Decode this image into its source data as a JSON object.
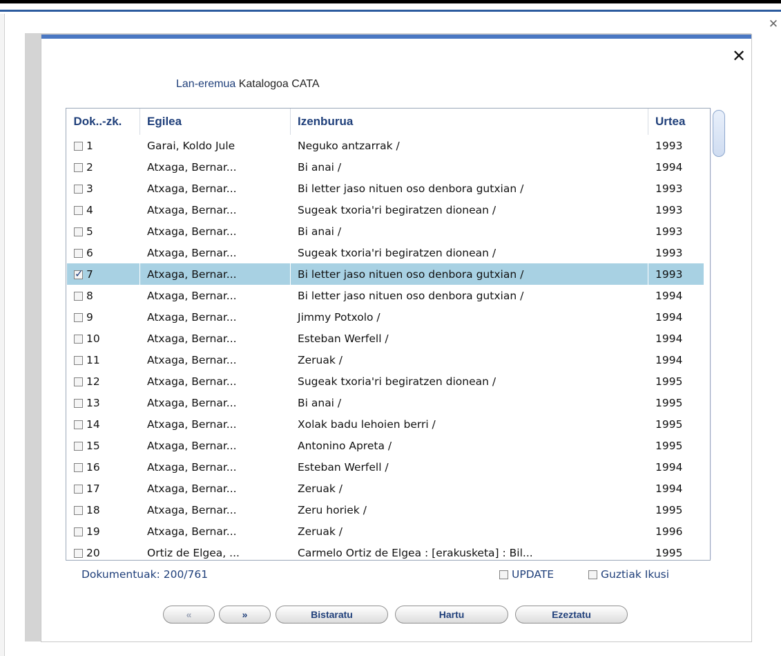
{
  "workspace": {
    "label": "Lan-eremua",
    "value": "Katalogoa CATA"
  },
  "columns": {
    "doc": "Dok..-zk.",
    "author": "Egilea",
    "title": "Izenburua",
    "year": "Urtea"
  },
  "rows": [
    {
      "num": "1",
      "author": "Garai, Koldo Jule",
      "title": "Neguko antzarrak /",
      "year": "1993",
      "checked": false
    },
    {
      "num": "2",
      "author": "Atxaga, Bernar...",
      "title": "Bi anai /",
      "year": "1994",
      "checked": false
    },
    {
      "num": "3",
      "author": "Atxaga, Bernar...",
      "title": "Bi letter jaso nituen oso denbora gutxian /",
      "year": "1993",
      "checked": false
    },
    {
      "num": "4",
      "author": "Atxaga, Bernar...",
      "title": "Sugeak txoria'ri begiratzen dionean /",
      "year": "1993",
      "checked": false
    },
    {
      "num": "5",
      "author": "Atxaga, Bernar...",
      "title": "Bi anai /",
      "year": "1993",
      "checked": false
    },
    {
      "num": "6",
      "author": "Atxaga, Bernar...",
      "title": "Sugeak txoria'ri begiratzen dionean /",
      "year": "1993",
      "checked": false
    },
    {
      "num": "7",
      "author": "Atxaga, Bernar...",
      "title": "Bi letter jaso nituen oso denbora gutxian /",
      "year": "1993",
      "checked": true
    },
    {
      "num": "8",
      "author": "Atxaga, Bernar...",
      "title": "Bi letter jaso nituen oso denbora gutxian /",
      "year": "1994",
      "checked": false
    },
    {
      "num": "9",
      "author": "Atxaga, Bernar...",
      "title": "Jimmy Potxolo /",
      "year": "1994",
      "checked": false
    },
    {
      "num": "10",
      "author": "Atxaga, Bernar...",
      "title": "Esteban Werfell /",
      "year": "1994",
      "checked": false
    },
    {
      "num": "11",
      "author": "Atxaga, Bernar...",
      "title": "Zeruak /",
      "year": "1994",
      "checked": false
    },
    {
      "num": "12",
      "author": "Atxaga, Bernar...",
      "title": "Sugeak txoria'ri begiratzen dionean /",
      "year": "1995",
      "checked": false
    },
    {
      "num": "13",
      "author": "Atxaga, Bernar...",
      "title": "Bi anai /",
      "year": "1995",
      "checked": false
    },
    {
      "num": "14",
      "author": "Atxaga, Bernar...",
      "title": "Xolak badu lehoien berri /",
      "year": "1995",
      "checked": false
    },
    {
      "num": "15",
      "author": "Atxaga, Bernar...",
      "title": "Antonino Apreta /",
      "year": "1995",
      "checked": false
    },
    {
      "num": "16",
      "author": "Atxaga, Bernar...",
      "title": "Esteban Werfell /",
      "year": "1994",
      "checked": false
    },
    {
      "num": "17",
      "author": "Atxaga, Bernar...",
      "title": "Zeruak /",
      "year": "1994",
      "checked": false
    },
    {
      "num": "18",
      "author": "Atxaga, Bernar...",
      "title": "Zeru horiek /",
      "year": "1995",
      "checked": false
    },
    {
      "num": "19",
      "author": "Atxaga, Bernar...",
      "title": "Zeruak /",
      "year": "1996",
      "checked": false
    },
    {
      "num": "20",
      "author": "Ortiz de Elgea, ...",
      "title": "Carmelo Ortiz de Elgea : [erakusketa] : Bil...",
      "year": "1995",
      "checked": false
    }
  ],
  "footer": {
    "docs": "Dokumentuak: 200/761",
    "update_label": "UPDATE",
    "all_label": "Guztiak Ikusi"
  },
  "buttons": {
    "prev": "«",
    "next": "»",
    "display": "Bistaratu",
    "accept": "Hartu",
    "cancel": "Ezeztatu"
  },
  "close_glyph": "✕",
  "dialog_close_glyph": "✕",
  "colors": {
    "accent": "#4a77c2",
    "selected_row": "#a8d1e3",
    "label_blue": "#1f3f7a"
  }
}
